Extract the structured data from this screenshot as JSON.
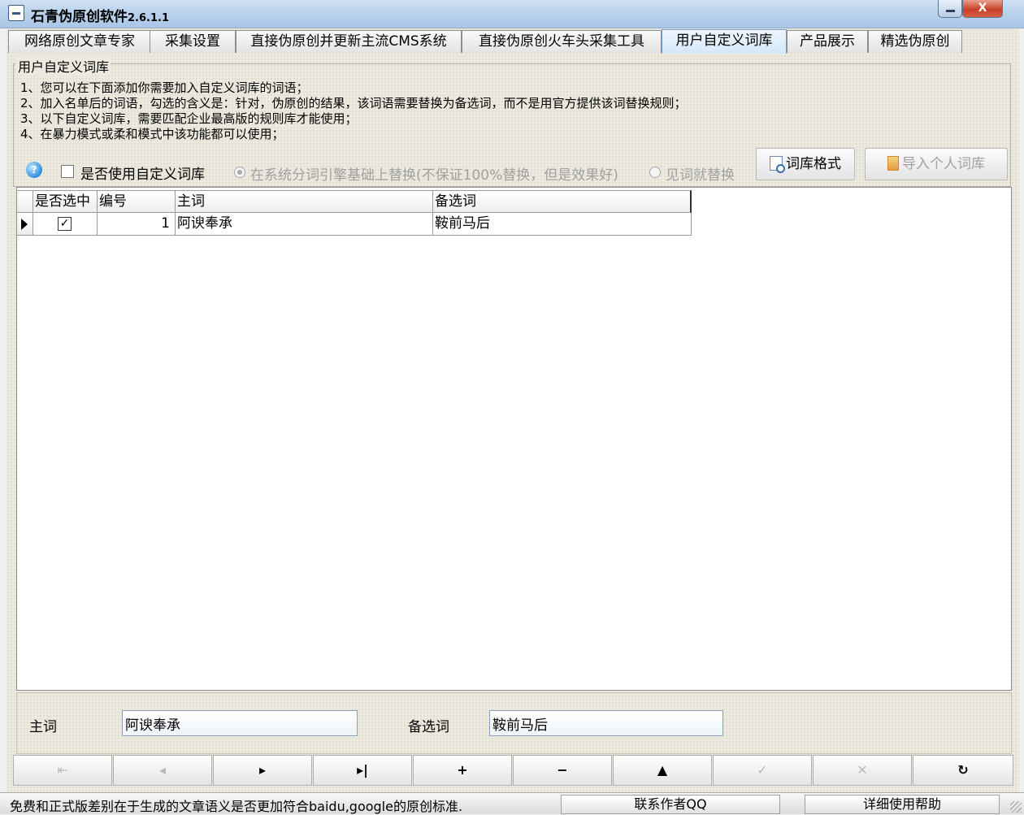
{
  "window": {
    "title": "石青伪原创软件",
    "version": "2.6.1.1",
    "close_glyph": "X"
  },
  "tabs": [
    {
      "label": "网络原创文章专家"
    },
    {
      "label": "采集设置"
    },
    {
      "label": "直接伪原创并更新主流CMS系统"
    },
    {
      "label": "直接伪原创火车头采集工具"
    },
    {
      "label": "用户自定义词库",
      "active": true
    },
    {
      "label": "产品展示"
    },
    {
      "label": "精选伪原创"
    }
  ],
  "group": {
    "legend": "用户自定义词库",
    "notes": [
      "1、您可以在下面添加你需要加入自定义词库的词语；",
      "2、加入名单后的词语，勾选的含义是：针对，伪原创的结果，该词语需要替换为备选词，而不是用官方提供该词替换规则；",
      "3、以下自定义词库，需要匹配企业最高版的规则库才能使用；",
      "4、在暴力模式或柔和模式中该功能都可以使用；"
    ],
    "use_checkbox_label": "是否使用自定义词库",
    "use_checked": false,
    "radio_engine_label": "在系统分词引擎基础上替换(不保证100%替换，但是效果好)",
    "radio_direct_label": "见词就替换",
    "btn_format": "词库格式",
    "btn_import": "导入个人词库"
  },
  "grid": {
    "columns": [
      "是否选中",
      "编号",
      "主词",
      "备选词"
    ],
    "rows": [
      {
        "selected": true,
        "id": "1",
        "main": "阿谀奉承",
        "alt": "鞍前马后"
      }
    ],
    "check_glyph": "✓"
  },
  "edit": {
    "main_label": "主词",
    "main_value": "阿谀奉承",
    "alt_label": "备选词",
    "alt_value": "鞍前马后"
  },
  "navigator": {
    "first": "⇤",
    "prior": "◂",
    "next": "▸",
    "last": "▸|",
    "insert": "+",
    "delete": "−",
    "edit": "▲",
    "post": "✓",
    "cancel": "✕",
    "refresh": "↻"
  },
  "status": {
    "message": "免费和正式版差别在于生成的文章语义是否更加符合baidu,google的原创标准.",
    "contact_qq": "联系作者QQ",
    "help": "详细使用帮助"
  }
}
